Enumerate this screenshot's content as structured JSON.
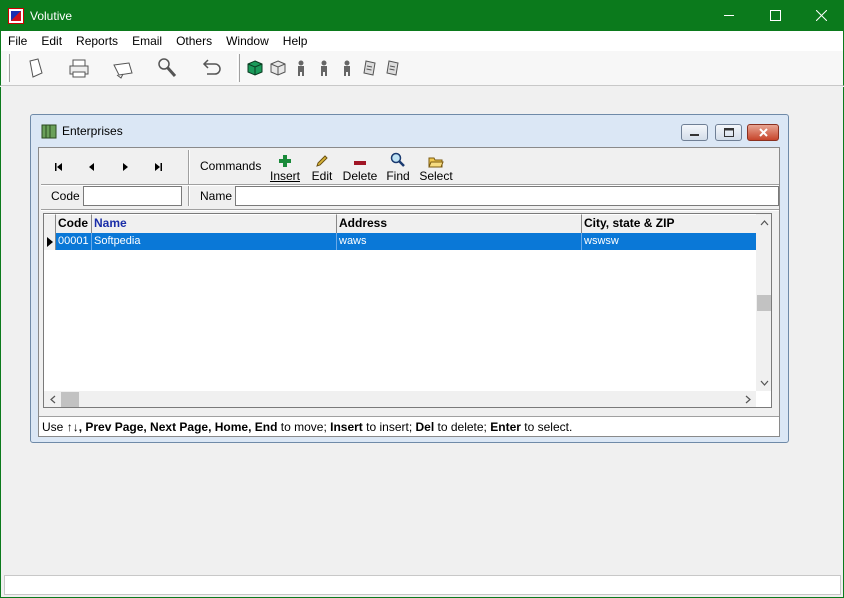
{
  "window": {
    "title": "Volutive"
  },
  "menu": [
    "File",
    "Edit",
    "Reports",
    "Email",
    "Others",
    "Window",
    "Help"
  ],
  "toolbar": {
    "buttons": [
      "new-document-icon",
      "print-icon",
      "copy-icon",
      "tools-icon",
      "undo-icon"
    ],
    "small_buttons": [
      "cube-green-icon",
      "cube-gray-icon",
      "person-icon",
      "person-icon",
      "person-icon",
      "document-icon",
      "document-icon"
    ]
  },
  "child": {
    "title": "Enterprises",
    "commands_label": "Commands",
    "commands": [
      {
        "label": "Insert",
        "icon": "plus-icon"
      },
      {
        "label": "Edit",
        "icon": "pencil-icon"
      },
      {
        "label": "Delete",
        "icon": "minus-icon"
      },
      {
        "label": "Find",
        "icon": "magnifier-icon"
      },
      {
        "label": "Select",
        "icon": "folder-icon"
      }
    ],
    "code_label": "Code",
    "code_value": "",
    "name_label": "Name",
    "name_value": ""
  },
  "grid": {
    "columns": [
      "Code",
      "Name",
      "Address",
      "City, state & ZIP"
    ],
    "rows": [
      {
        "code": "00001",
        "name": "Softpedia",
        "address": "waws",
        "city": "wswsw"
      }
    ]
  },
  "status_line": {
    "prefix": "Use ",
    "arrows": "↑↓",
    "k1": ", Prev Page, Next Page, Home, End",
    "t1": " to move; ",
    "k2": "Insert",
    "t2": " to insert; ",
    "k3": "Del",
    "t3": " to delete; ",
    "k4": "Enter",
    "t4": " to select."
  },
  "colors": {
    "titlebar": "#0b7a1c",
    "selection": "#0a78d7",
    "name_header": "#1b2ea8"
  }
}
